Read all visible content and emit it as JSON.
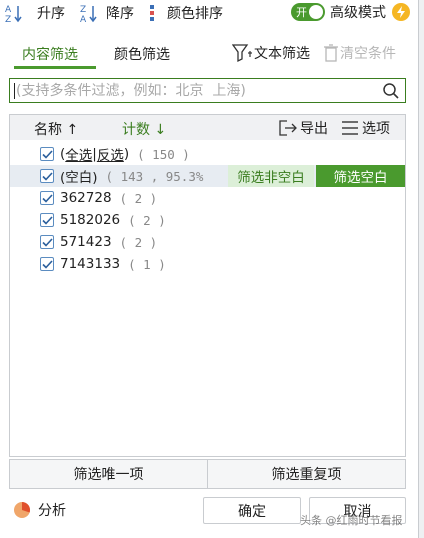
{
  "toolbar": {
    "sort_asc": "升序",
    "sort_desc": "降序",
    "color_sort": "颜色排序",
    "toggle_state": "开",
    "advanced_mode": "高级模式"
  },
  "tabs": {
    "content_filter": "内容筛选",
    "color_filter": "颜色筛选",
    "text_filter": "文本筛选",
    "clear_conditions": "清空条件"
  },
  "search": {
    "placeholder": "(支持多条件过滤，例如：北京  上海)"
  },
  "list": {
    "header": {
      "name": "名称",
      "count": "计数",
      "export": "导出",
      "options": "选项"
    },
    "select_all": "全选",
    "separator": "|",
    "invert": "反选",
    "select_all_count": "( 150 )",
    "rows": [
      {
        "label": "(空白)",
        "count": "( 143 , 95.3%",
        "checked": true
      },
      {
        "label": "362728",
        "count": "( 2 )",
        "checked": true
      },
      {
        "label": "5182026",
        "count": "( 2 )",
        "checked": true
      },
      {
        "label": "571423",
        "count": "( 2 )",
        "checked": true
      },
      {
        "label": "7143133",
        "count": "( 1 )",
        "checked": true
      }
    ],
    "filter_non_empty": "筛选非空白",
    "filter_empty": "筛选空白"
  },
  "actions": {
    "unique": "筛选唯一项",
    "duplicate": "筛选重复项",
    "analyze": "分析",
    "ok": "确定",
    "cancel": "取消"
  },
  "watermark": "头条 @红雨时节看报",
  "colors": {
    "accent": "#4a9a2e",
    "accent_text": "#3a7d1f",
    "highlight_row": "#e7ecf2"
  }
}
